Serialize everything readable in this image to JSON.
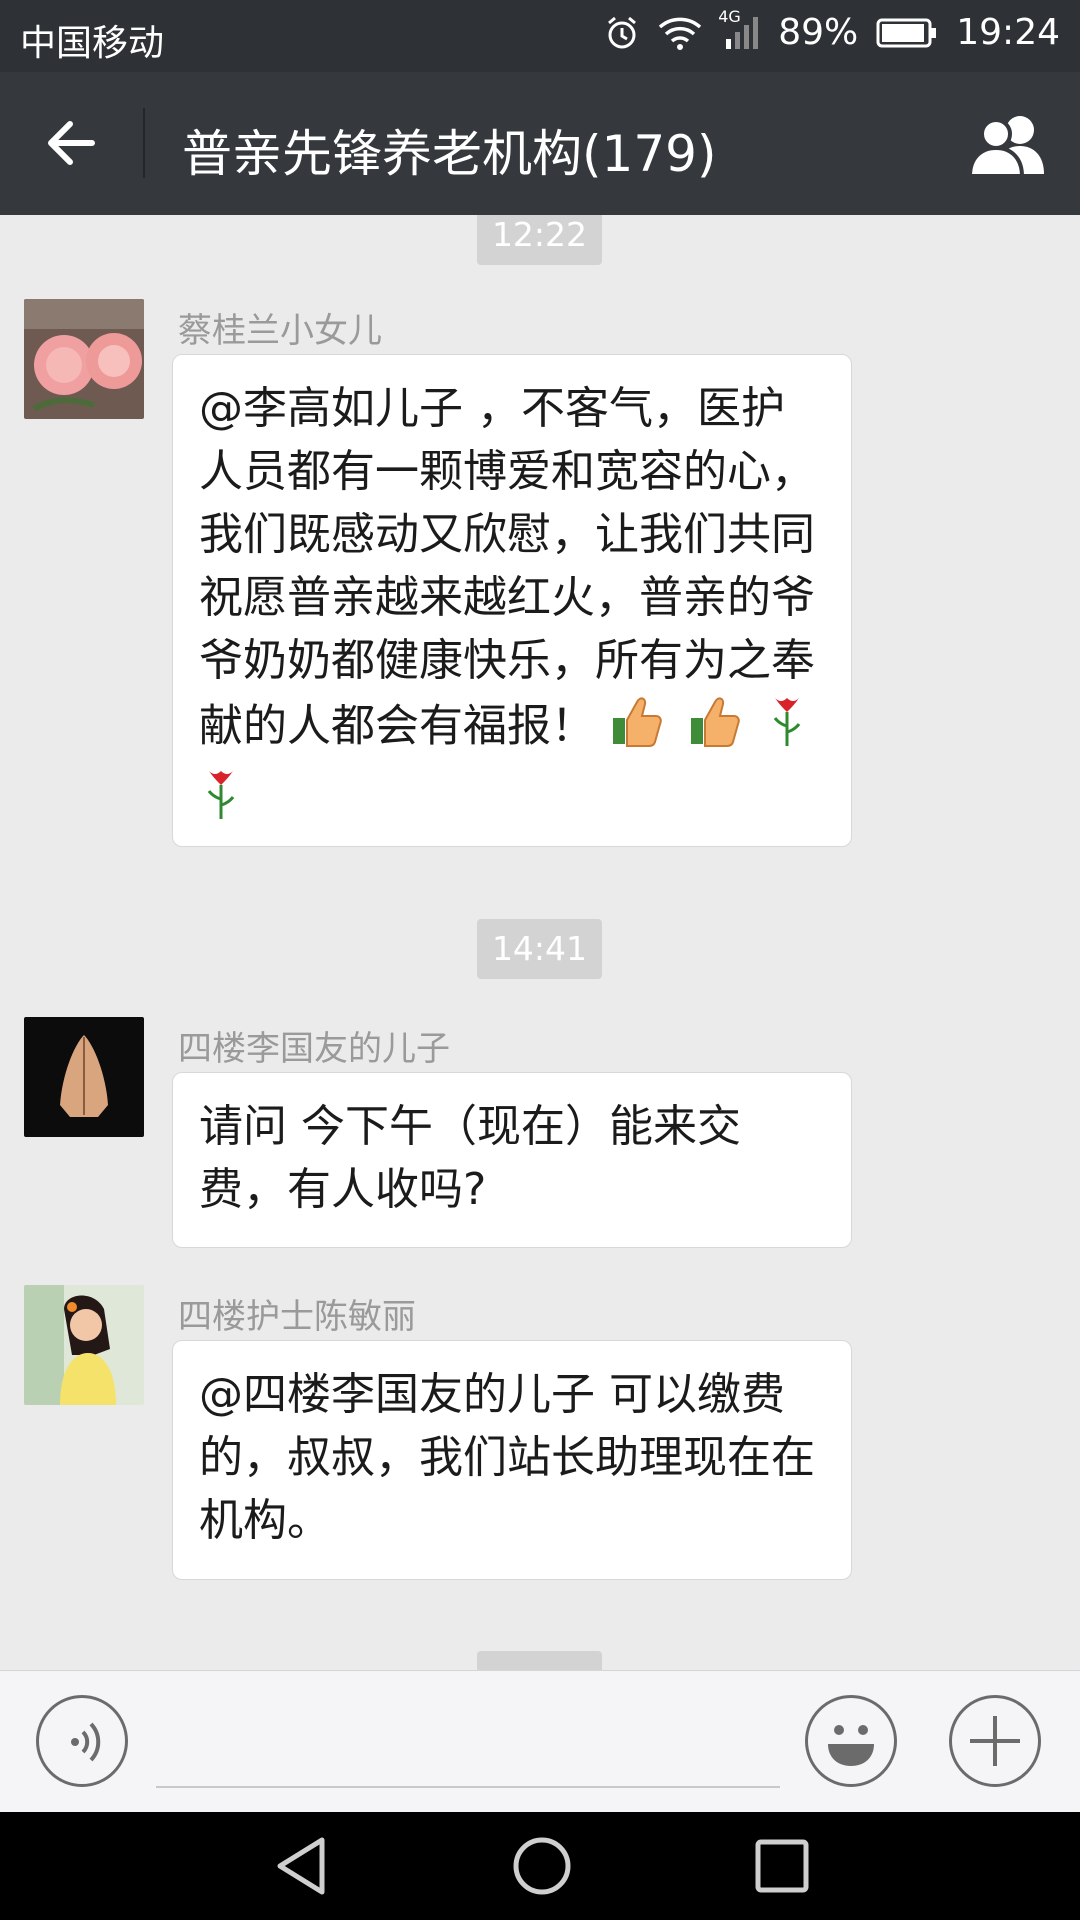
{
  "status_bar": {
    "carrier": "中国移动",
    "network": "4G",
    "battery": "89%",
    "time": "19:24"
  },
  "nav": {
    "title": "普亲先锋养老机构(179)"
  },
  "messages": [
    {
      "type": "time",
      "text": "12:22"
    },
    {
      "type": "message",
      "sender": "蔡桂兰小女儿",
      "text": "@李高如儿子 ，不客气，医护人员都有一颗博爱和宽容的心，我们既感动又欣慰，让我们共同祝愿普亲越来越红火，普亲的爷爷奶奶都健康快乐，所有为之奉献的人都会有福报！",
      "emojis": [
        "thumbs-up",
        "thumbs-up",
        "rose",
        "rose"
      ]
    },
    {
      "type": "time",
      "text": "14:41"
    },
    {
      "type": "message",
      "sender": "四楼李国友的儿子",
      "text": "请问   今下午（现在）能来交费，有人收吗?"
    },
    {
      "type": "message",
      "sender": "四楼护士陈敏丽",
      "text": "@四楼李国友的儿子 可以缴费的，叔叔，我们站长助理现在在机构。"
    }
  ]
}
